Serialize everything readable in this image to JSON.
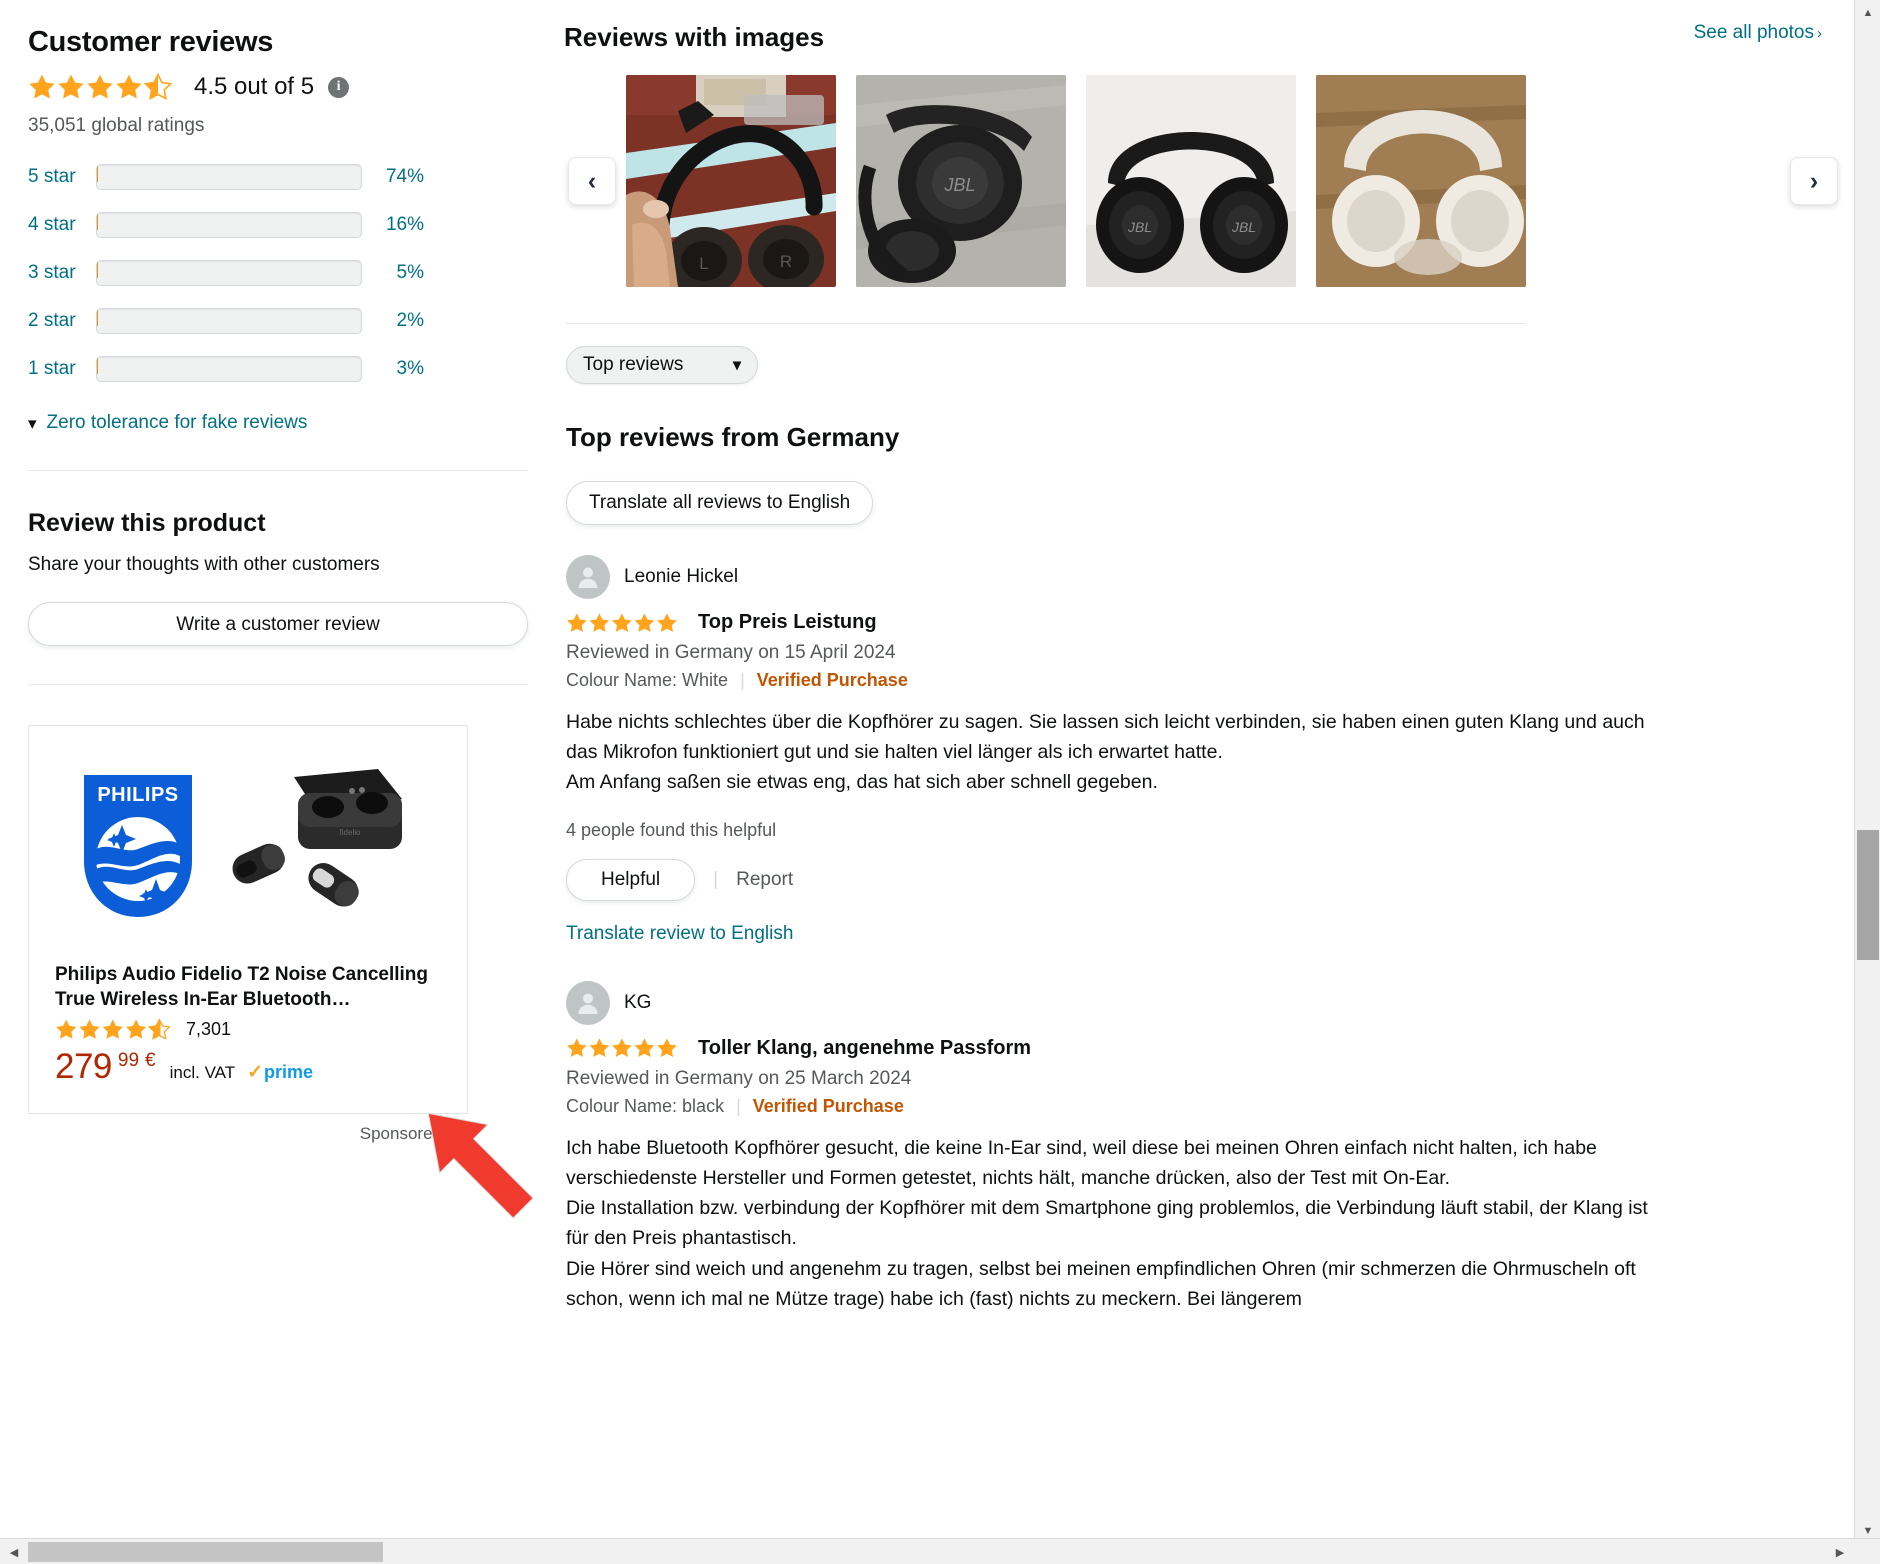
{
  "left": {
    "section_title": "Customer reviews",
    "rating_value": "4.5 out of 5",
    "rating_stars": 4.5,
    "info_glyph": "i",
    "global_ratings": "35,051 global ratings",
    "histogram": [
      {
        "label": "5 star",
        "percent": "74%",
        "value": 74
      },
      {
        "label": "4 star",
        "percent": "16%",
        "value": 16
      },
      {
        "label": "3 star",
        "percent": "5%",
        "value": 5
      },
      {
        "label": "2 star",
        "percent": "2%",
        "value": 2
      },
      {
        "label": "1 star",
        "percent": "3%",
        "value": 3
      }
    ],
    "zero_tolerance": "Zero tolerance for fake reviews",
    "review_product_title": "Review this product",
    "share_thoughts": "Share your thoughts with other customers",
    "write_review_button": "Write a customer review",
    "sponsored": {
      "brand_logo_text": "PHILIPS",
      "product_title": "Philips Audio Fidelio T2 Noise Cancelling True Wireless In-Ear Bluetooth Kopfhörer...",
      "stars": 4.3,
      "review_count": "7,301",
      "price_whole": "279",
      "price_fraction": "99",
      "currency": "€",
      "vat_text": "incl. VAT",
      "prime_text": "prime",
      "sponsored_label": "Sponsored",
      "info_glyph": "i"
    }
  },
  "right": {
    "reviews_with_images_title": "Reviews with images",
    "see_all_photos": "See all photos",
    "see_all_caret": "›",
    "carousel": {
      "prev_label": "‹",
      "next_label": "›",
      "items": [
        {
          "alt": "black-on-ear-headphones-held-over-striped-rug"
        },
        {
          "alt": "jbl-headphones-folded-on-grey-fabric"
        },
        {
          "alt": "black-jbl-headphones-on-white-sheet"
        },
        {
          "alt": "white-headphones-on-wooden-table"
        }
      ]
    },
    "sort_selected": "Top reviews",
    "sort_caret": "⌄",
    "top_reviews_title": "Top reviews from Germany",
    "translate_all_button": "Translate all reviews to English",
    "reviews": [
      {
        "user": "Leonie Hickel",
        "stars": 5,
        "title": "Top Preis Leistung",
        "meta": "Reviewed in Germany on 15 April 2024",
        "variant": "Colour Name: White",
        "verified": "Verified Purchase",
        "body_lines": [
          "Habe nichts schlechtes über die Kopfhörer zu sagen. Sie lassen sich leicht verbinden, sie haben einen guten Klang und auch das Mikrofon funktioniert gut und sie halten viel länger als ich erwartet hatte.",
          "Am Anfang saßen sie etwas eng, das hat sich aber schnell gegeben."
        ],
        "helpful_count": "4 people found this helpful",
        "helpful_button": "Helpful",
        "report_label": "Report",
        "translate_link": "Translate review to English"
      },
      {
        "user": "KG",
        "stars": 5,
        "title": "Toller Klang, angenehme Passform",
        "meta": "Reviewed in Germany on 25 March 2024",
        "variant": "Colour Name: black",
        "verified": "Verified Purchase",
        "body_lines": [
          "Ich habe Bluetooth Kopfhörer gesucht, die keine In-Ear sind, weil diese bei meinen Ohren einfach nicht halten, ich habe verschiedenste Hersteller und Formen getestet, nichts hält, manche drücken, also der Test mit On-Ear.",
          "Die Installation bzw. verbindung der Kopfhörer mit dem Smartphone ging problemlos, die Verbindung läuft stabil, der Klang ist für den Preis phantastisch.",
          "Die Hörer sind weich und angenehm zu tragen, selbst bei meinen empfindlichen Ohren (mir schmerzen die Ohrmuscheln oft schon, wenn ich mal ne Mütze trage) habe ich (fast) nichts zu meckern. Bei längerem"
        ]
      }
    ]
  },
  "colors": {
    "star_orange": "#FFA41C",
    "link_teal": "#007185",
    "price_red": "#B12704",
    "verified_orange": "#C45500",
    "annotation_red": "#F03A2E"
  }
}
